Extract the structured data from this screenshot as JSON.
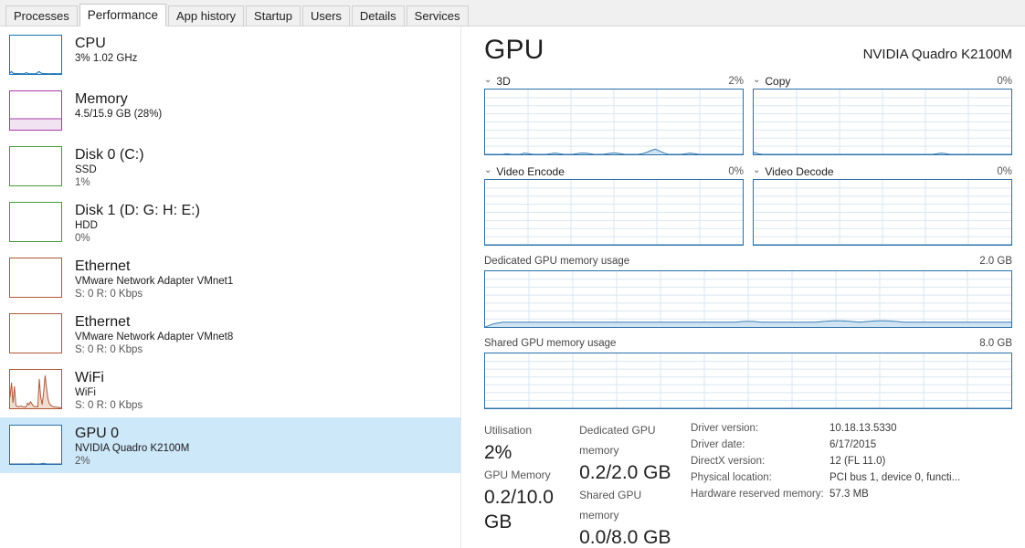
{
  "tabs": [
    {
      "label": "Processes",
      "active": false
    },
    {
      "label": "Performance",
      "active": true
    },
    {
      "label": "App history",
      "active": false
    },
    {
      "label": "Startup",
      "active": false
    },
    {
      "label": "Users",
      "active": false
    },
    {
      "label": "Details",
      "active": false
    },
    {
      "label": "Services",
      "active": false
    }
  ],
  "sidebar": {
    "items": [
      {
        "title": "CPU",
        "sub1": "3%  1.02 GHz",
        "sub2": "",
        "color": "#1a72b8",
        "selected": false
      },
      {
        "title": "Memory",
        "sub1": "4.5/15.9 GB (28%)",
        "sub2": "",
        "color": "#a83ba8",
        "selected": false
      },
      {
        "title": "Disk 0 (C:)",
        "sub1": "SSD",
        "sub2": "1%",
        "color": "#4a9a3a",
        "selected": false
      },
      {
        "title": "Disk 1 (D: G: H: E:)",
        "sub1": "HDD",
        "sub2": "0%",
        "color": "#4a9a3a",
        "selected": false
      },
      {
        "title": "Ethernet",
        "sub1": "VMware Network Adapter VMnet1",
        "sub2": "S: 0 R: 0 Kbps",
        "color": "#b05838",
        "selected": false
      },
      {
        "title": "Ethernet",
        "sub1": "VMware Network Adapter VMnet8",
        "sub2": "S: 0 R: 0 Kbps",
        "color": "#b05838",
        "selected": false
      },
      {
        "title": "WiFi",
        "sub1": "WiFi",
        "sub2": "S: 0 R: 0 Kbps",
        "color": "#b05838",
        "selected": false
      },
      {
        "title": "GPU 0",
        "sub1": "NVIDIA Quadro K2100M",
        "sub2": "2%",
        "color": "#2a6fa8",
        "selected": true
      }
    ]
  },
  "main": {
    "title": "GPU",
    "device": "NVIDIA Quadro K2100M",
    "engines": [
      {
        "name": "3D",
        "value": "2%"
      },
      {
        "name": "Copy",
        "value": "0%"
      },
      {
        "name": "Video Encode",
        "value": "0%"
      },
      {
        "name": "Video Decode",
        "value": "0%"
      }
    ],
    "memory_graphs": [
      {
        "name": "Dedicated GPU memory usage",
        "max": "2.0 GB"
      },
      {
        "name": "Shared GPU memory usage",
        "max": "8.0 GB"
      }
    ],
    "stats": [
      {
        "key": "Utilisation",
        "value": "2%"
      },
      {
        "key": "GPU Memory",
        "value": "0.2/10.0 GB"
      },
      {
        "key": "Dedicated GPU memory",
        "value": "0.2/2.0 GB"
      },
      {
        "key": "Shared GPU memory",
        "value": "0.0/8.0 GB"
      }
    ],
    "details": [
      {
        "key": "Driver version:",
        "value": "10.18.13.5330"
      },
      {
        "key": "Driver date:",
        "value": "6/17/2015"
      },
      {
        "key": "DirectX version:",
        "value": "12 (FL 11.0)"
      },
      {
        "key": "Physical location:",
        "value": "PCI bus 1, device 0, functi..."
      },
      {
        "key": "Hardware reserved memory:",
        "value": "57.3 MB"
      }
    ]
  },
  "icons": {
    "chevron_down": "⌄"
  },
  "colors": {
    "graph_border": "#2a6fa8",
    "graph_line": "#3a7fb5",
    "graph_fill": "#cfe3f2",
    "grid": "#d9e7f2",
    "selection": "#cde8f9"
  },
  "chart_data": {
    "type": "line",
    "title": "GPU engine and memory utilisation over 60 seconds",
    "charts": [
      {
        "name": "3D",
        "ylabel": "%",
        "ylim": [
          0,
          100
        ],
        "current": 2,
        "values": [
          0,
          0,
          0,
          0,
          0,
          1,
          0,
          0,
          0,
          2,
          1,
          0,
          0,
          0,
          0,
          1,
          2,
          1,
          0,
          0,
          0,
          1,
          2,
          2,
          1,
          0,
          0,
          0,
          1,
          2,
          2,
          1,
          0,
          0,
          0,
          0,
          1,
          3,
          6,
          8,
          5,
          2,
          0,
          0,
          0,
          0,
          1,
          2,
          1,
          0,
          0,
          0,
          0,
          0,
          0,
          0,
          0,
          0,
          0,
          0
        ]
      },
      {
        "name": "Copy",
        "ylabel": "%",
        "ylim": [
          0,
          100
        ],
        "current": 0,
        "values": [
          3,
          1,
          0,
          0,
          0,
          0,
          0,
          0,
          0,
          0,
          0,
          0,
          0,
          0,
          0,
          0,
          0,
          0,
          0,
          0,
          0,
          0,
          0,
          0,
          0,
          0,
          0,
          0,
          0,
          0,
          0,
          0,
          0,
          0,
          0,
          0,
          0,
          0,
          0,
          0,
          0,
          0,
          1,
          2,
          1,
          0,
          0,
          0,
          0,
          0,
          0,
          0,
          0,
          0,
          0,
          0,
          0,
          0,
          0,
          0
        ]
      },
      {
        "name": "Video Encode",
        "ylabel": "%",
        "ylim": [
          0,
          100
        ],
        "current": 0,
        "values": [
          0,
          0,
          0,
          0,
          0,
          0,
          0,
          0,
          0,
          0,
          0,
          0,
          0,
          0,
          0,
          0,
          0,
          0,
          0,
          0,
          0,
          0,
          0,
          0,
          0,
          0,
          0,
          0,
          0,
          0,
          0,
          0,
          0,
          0,
          0,
          0,
          0,
          0,
          0,
          0,
          0,
          0,
          0,
          0,
          0,
          0,
          0,
          0,
          0,
          0,
          0,
          0,
          0,
          0,
          0,
          0,
          0,
          0,
          0,
          0
        ]
      },
      {
        "name": "Video Decode",
        "ylabel": "%",
        "ylim": [
          0,
          100
        ],
        "current": 0,
        "values": [
          0,
          0,
          0,
          0,
          0,
          0,
          0,
          0,
          0,
          0,
          0,
          0,
          0,
          0,
          0,
          0,
          0,
          0,
          0,
          0,
          0,
          0,
          0,
          0,
          0,
          0,
          0,
          0,
          0,
          0,
          0,
          0,
          0,
          0,
          0,
          0,
          0,
          0,
          0,
          0,
          0,
          0,
          0,
          0,
          0,
          0,
          0,
          0,
          0,
          0,
          0,
          0,
          0,
          0,
          0,
          0,
          0,
          0,
          0,
          0
        ]
      },
      {
        "name": "Dedicated GPU memory usage",
        "ylabel": "GB",
        "ylim": [
          0,
          2.0
        ],
        "current": 0.2,
        "values": [
          0.0,
          0.12,
          0.17,
          0.17,
          0.17,
          0.17,
          0.17,
          0.17,
          0.17,
          0.17,
          0.17,
          0.17,
          0.17,
          0.17,
          0.17,
          0.17,
          0.17,
          0.17,
          0.17,
          0.17,
          0.17,
          0.17,
          0.17,
          0.17,
          0.17,
          0.17,
          0.17,
          0.17,
          0.17,
          0.2,
          0.2,
          0.17,
          0.17,
          0.17,
          0.17,
          0.17,
          0.17,
          0.17,
          0.2,
          0.22,
          0.22,
          0.2,
          0.17,
          0.2,
          0.22,
          0.22,
          0.2,
          0.17,
          0.17,
          0.17,
          0.17,
          0.17,
          0.17,
          0.17,
          0.17,
          0.17,
          0.17,
          0.17,
          0.17,
          0.17
        ]
      },
      {
        "name": "Shared GPU memory usage",
        "ylabel": "GB",
        "ylim": [
          0,
          8.0
        ],
        "current": 0.0,
        "values": [
          0,
          0,
          0,
          0,
          0,
          0,
          0,
          0,
          0,
          0,
          0,
          0,
          0,
          0,
          0,
          0,
          0,
          0,
          0,
          0,
          0,
          0,
          0,
          0,
          0,
          0,
          0,
          0,
          0,
          0,
          0,
          0,
          0,
          0,
          0,
          0,
          0,
          0,
          0,
          0,
          0,
          0,
          0,
          0,
          0,
          0,
          0,
          0,
          0,
          0,
          0,
          0,
          0,
          0,
          0,
          0,
          0,
          0,
          0,
          0
        ]
      },
      {
        "name": "CPU thumbnail",
        "ylabel": "%",
        "ylim": [
          0,
          100
        ],
        "current": 3,
        "values": [
          10,
          22,
          8,
          5,
          3,
          4,
          3,
          2,
          3,
          2,
          4,
          12,
          6,
          3,
          2,
          3,
          2,
          2,
          4,
          16,
          20,
          10,
          5,
          3,
          4,
          3,
          2,
          2,
          3,
          2,
          3,
          3,
          2,
          2,
          3,
          3
        ]
      },
      {
        "name": "WiFi thumbnail",
        "ylabel": "Kbps",
        "ylim": [
          0,
          100
        ],
        "current": 0,
        "values": [
          30,
          70,
          15,
          60,
          8,
          5,
          4,
          6,
          5,
          4,
          3,
          4,
          14,
          10,
          18,
          12,
          6,
          4,
          5,
          4,
          80,
          30,
          10,
          45,
          90,
          55,
          25,
          12,
          8,
          5,
          4,
          3,
          3,
          2,
          2,
          2
        ]
      },
      {
        "name": "GPU 0 thumbnail",
        "ylabel": "%",
        "ylim": [
          0,
          100
        ],
        "current": 2,
        "values": [
          0,
          0,
          0,
          0,
          0,
          0,
          0,
          0,
          0,
          0,
          0,
          0,
          0,
          0,
          1,
          2,
          1,
          0,
          0,
          0,
          0,
          2,
          5,
          8,
          4,
          1,
          0,
          0,
          0,
          0,
          0,
          0,
          0,
          0,
          0,
          0
        ]
      }
    ]
  }
}
